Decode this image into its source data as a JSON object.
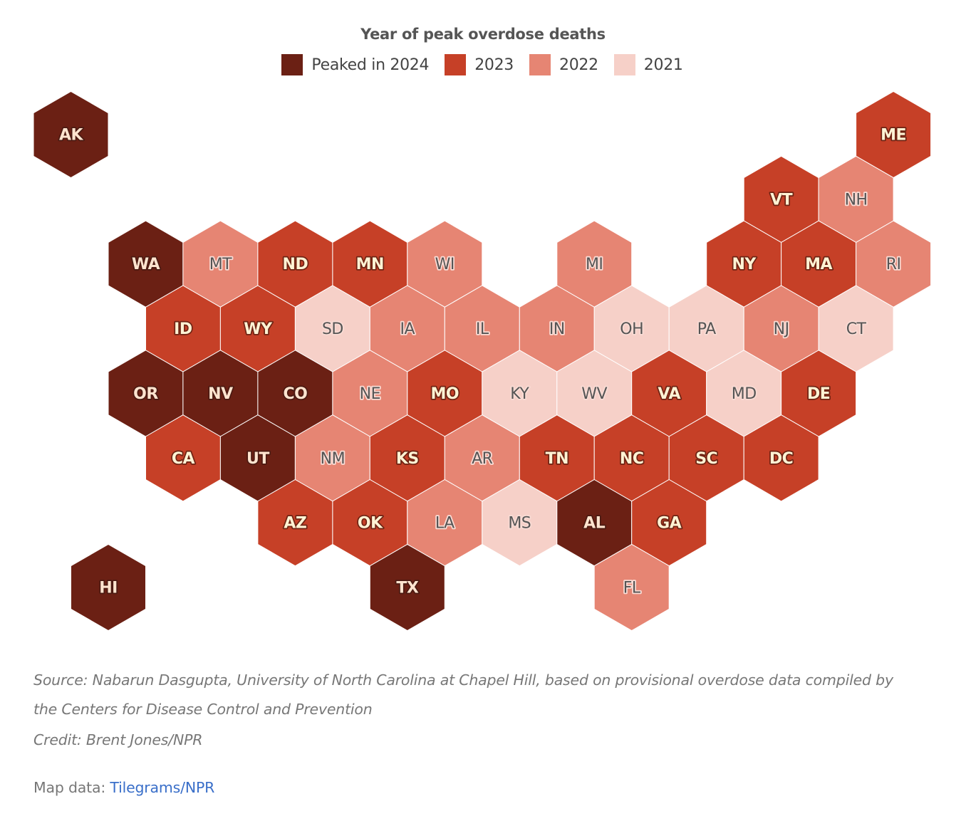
{
  "chart_data": {
    "type": "heatmap",
    "subtype": "hexagon-tile-map",
    "title": "Year of peak overdose deaths",
    "legend": {
      "placement": "top-center",
      "items": [
        {
          "key": "2024",
          "label": "Peaked in 2024",
          "color": "#6b2014"
        },
        {
          "key": "2023",
          "label": "2023",
          "color": "#c64027"
        },
        {
          "key": "2022",
          "label": "2022",
          "color": "#e68573"
        },
        {
          "key": "2021",
          "label": "2021",
          "color": "#f6d0c8"
        }
      ]
    },
    "states": [
      {
        "abbr": "AK",
        "peak_year": 2024,
        "grid": [
          0,
          0
        ]
      },
      {
        "abbr": "ME",
        "peak_year": 2023,
        "grid": [
          22,
          0
        ]
      },
      {
        "abbr": "VT",
        "peak_year": 2023,
        "grid": [
          19,
          1
        ]
      },
      {
        "abbr": "NH",
        "peak_year": 2022,
        "grid": [
          21,
          1
        ]
      },
      {
        "abbr": "WA",
        "peak_year": 2024,
        "grid": [
          2,
          2
        ]
      },
      {
        "abbr": "MT",
        "peak_year": 2022,
        "grid": [
          4,
          2
        ]
      },
      {
        "abbr": "ND",
        "peak_year": 2023,
        "grid": [
          6,
          2
        ]
      },
      {
        "abbr": "MN",
        "peak_year": 2023,
        "grid": [
          8,
          2
        ]
      },
      {
        "abbr": "WI",
        "peak_year": 2022,
        "grid": [
          10,
          2
        ]
      },
      {
        "abbr": "MI",
        "peak_year": 2022,
        "grid": [
          14,
          2
        ]
      },
      {
        "abbr": "NY",
        "peak_year": 2023,
        "grid": [
          18,
          2
        ]
      },
      {
        "abbr": "MA",
        "peak_year": 2023,
        "grid": [
          20,
          2
        ]
      },
      {
        "abbr": "RI",
        "peak_year": 2022,
        "grid": [
          22,
          2
        ]
      },
      {
        "abbr": "ID",
        "peak_year": 2023,
        "grid": [
          3,
          3
        ]
      },
      {
        "abbr": "WY",
        "peak_year": 2023,
        "grid": [
          5,
          3
        ]
      },
      {
        "abbr": "SD",
        "peak_year": 2021,
        "grid": [
          7,
          3
        ]
      },
      {
        "abbr": "IA",
        "peak_year": 2022,
        "grid": [
          9,
          3
        ]
      },
      {
        "abbr": "IL",
        "peak_year": 2022,
        "grid": [
          11,
          3
        ]
      },
      {
        "abbr": "IN",
        "peak_year": 2022,
        "grid": [
          13,
          3
        ]
      },
      {
        "abbr": "OH",
        "peak_year": 2021,
        "grid": [
          15,
          3
        ]
      },
      {
        "abbr": "PA",
        "peak_year": 2021,
        "grid": [
          17,
          3
        ]
      },
      {
        "abbr": "NJ",
        "peak_year": 2022,
        "grid": [
          19,
          3
        ]
      },
      {
        "abbr": "CT",
        "peak_year": 2021,
        "grid": [
          21,
          3
        ]
      },
      {
        "abbr": "OR",
        "peak_year": 2024,
        "grid": [
          2,
          4
        ]
      },
      {
        "abbr": "NV",
        "peak_year": 2024,
        "grid": [
          4,
          4
        ]
      },
      {
        "abbr": "CO",
        "peak_year": 2024,
        "grid": [
          6,
          4
        ]
      },
      {
        "abbr": "NE",
        "peak_year": 2022,
        "grid": [
          8,
          4
        ]
      },
      {
        "abbr": "MO",
        "peak_year": 2023,
        "grid": [
          10,
          4
        ]
      },
      {
        "abbr": "KY",
        "peak_year": 2021,
        "grid": [
          12,
          4
        ]
      },
      {
        "abbr": "WV",
        "peak_year": 2021,
        "grid": [
          14,
          4
        ]
      },
      {
        "abbr": "VA",
        "peak_year": 2023,
        "grid": [
          16,
          4
        ]
      },
      {
        "abbr": "MD",
        "peak_year": 2021,
        "grid": [
          18,
          4
        ]
      },
      {
        "abbr": "DE",
        "peak_year": 2023,
        "grid": [
          20,
          4
        ]
      },
      {
        "abbr": "CA",
        "peak_year": 2023,
        "grid": [
          3,
          5
        ]
      },
      {
        "abbr": "UT",
        "peak_year": 2024,
        "grid": [
          5,
          5
        ]
      },
      {
        "abbr": "NM",
        "peak_year": 2022,
        "grid": [
          7,
          5
        ]
      },
      {
        "abbr": "KS",
        "peak_year": 2023,
        "grid": [
          9,
          5
        ]
      },
      {
        "abbr": "AR",
        "peak_year": 2022,
        "grid": [
          11,
          5
        ]
      },
      {
        "abbr": "TN",
        "peak_year": 2023,
        "grid": [
          13,
          5
        ]
      },
      {
        "abbr": "NC",
        "peak_year": 2023,
        "grid": [
          15,
          5
        ]
      },
      {
        "abbr": "SC",
        "peak_year": 2023,
        "grid": [
          17,
          5
        ]
      },
      {
        "abbr": "DC",
        "peak_year": 2023,
        "grid": [
          19,
          5
        ]
      },
      {
        "abbr": "AZ",
        "peak_year": 2023,
        "grid": [
          6,
          6
        ]
      },
      {
        "abbr": "OK",
        "peak_year": 2023,
        "grid": [
          8,
          6
        ]
      },
      {
        "abbr": "LA",
        "peak_year": 2022,
        "grid": [
          10,
          6
        ]
      },
      {
        "abbr": "MS",
        "peak_year": 2021,
        "grid": [
          12,
          6
        ]
      },
      {
        "abbr": "AL",
        "peak_year": 2024,
        "grid": [
          14,
          6
        ]
      },
      {
        "abbr": "GA",
        "peak_year": 2023,
        "grid": [
          16,
          6
        ]
      },
      {
        "abbr": "HI",
        "peak_year": 2024,
        "grid": [
          1,
          7
        ]
      },
      {
        "abbr": "TX",
        "peak_year": 2024,
        "grid": [
          9,
          7
        ]
      },
      {
        "abbr": "FL",
        "peak_year": 2022,
        "grid": [
          15,
          7
        ]
      }
    ]
  },
  "footer": {
    "source": "Source: Nabarun Dasgupta, University of North Carolina at Chapel Hill, based on provisional overdose data compiled by the Centers for Disease Control and Prevention",
    "credit": "Credit: Brent Jones/NPR",
    "map_data_label": "Map data: ",
    "map_data_link": "Tilegrams/NPR"
  }
}
